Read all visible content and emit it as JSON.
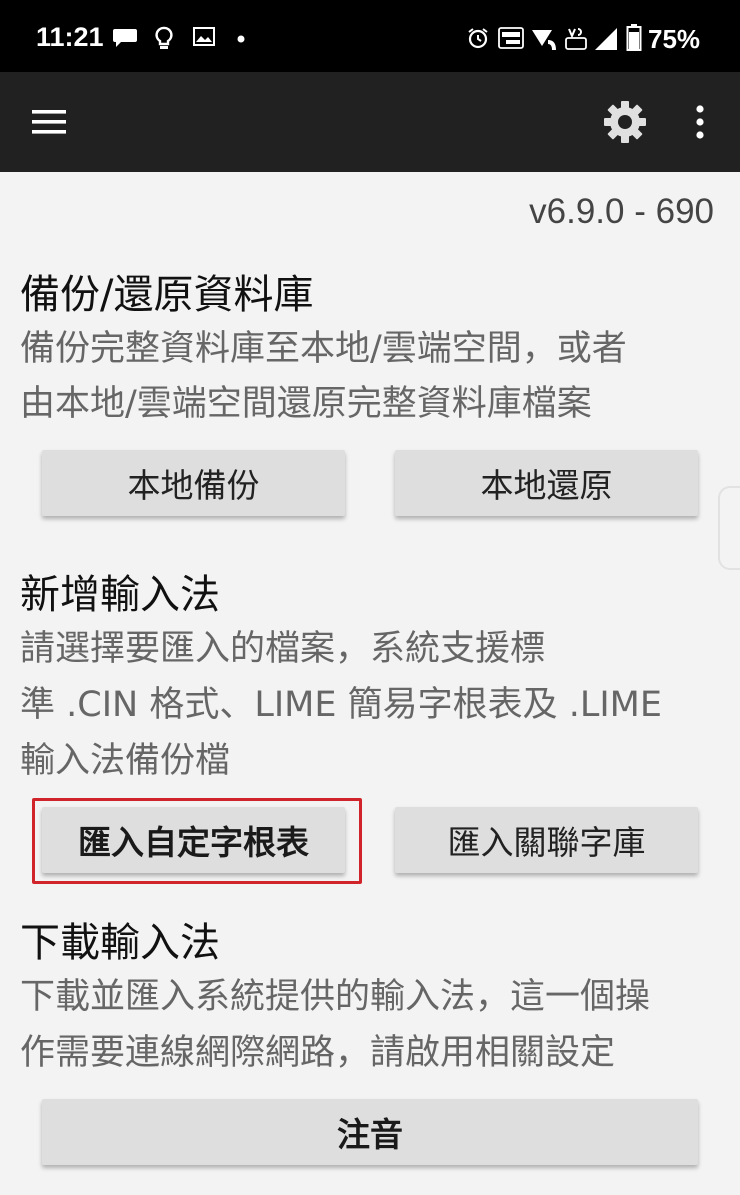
{
  "status_bar": {
    "time": "11:21",
    "battery": "75%",
    "left_icons": [
      "chat-bubble-icon",
      "lightbulb-icon",
      "image-icon",
      "dot-icon"
    ],
    "right_icons": [
      "alarm-icon",
      "auto-hz-icon",
      "wifi-calling-icon",
      "volte-icon",
      "signal-icon",
      "battery-icon"
    ]
  },
  "app_bar": {
    "icons": [
      "menu-icon",
      "gear-icon",
      "more-vert-icon"
    ]
  },
  "version": "v6.9.0 - 690",
  "backup": {
    "title": "備份/還原資料庫",
    "desc_line1": "備份完整資料庫至本地/雲端空間，或者",
    "desc_line2": "由本地/雲端空間還原完整資料庫檔案",
    "local_backup": "本地備份",
    "local_restore": "本地還原"
  },
  "add_im": {
    "title": "新增輸入法",
    "desc_line1": "請選擇要匯入的檔案，系統支援標",
    "desc_line2": "準 .CIN 格式、LIME 簡易字根表及 .LIME",
    "desc_line3": "輸入法備份檔",
    "import_custom": "匯入自定字根表",
    "import_related": "匯入關聯字庫"
  },
  "download_im": {
    "title": "下載輸入法",
    "desc_line1": "下載並匯入系統提供的輸入法，這一個操",
    "desc_line2": "作需要連線網際網路，請啟用相關設定",
    "zhuyin": "注音"
  },
  "colors": {
    "status_bar": "#000000",
    "app_bar": "#212121",
    "background": "#f3f3f3",
    "button": "#dedede",
    "highlight": "#d0242a"
  }
}
